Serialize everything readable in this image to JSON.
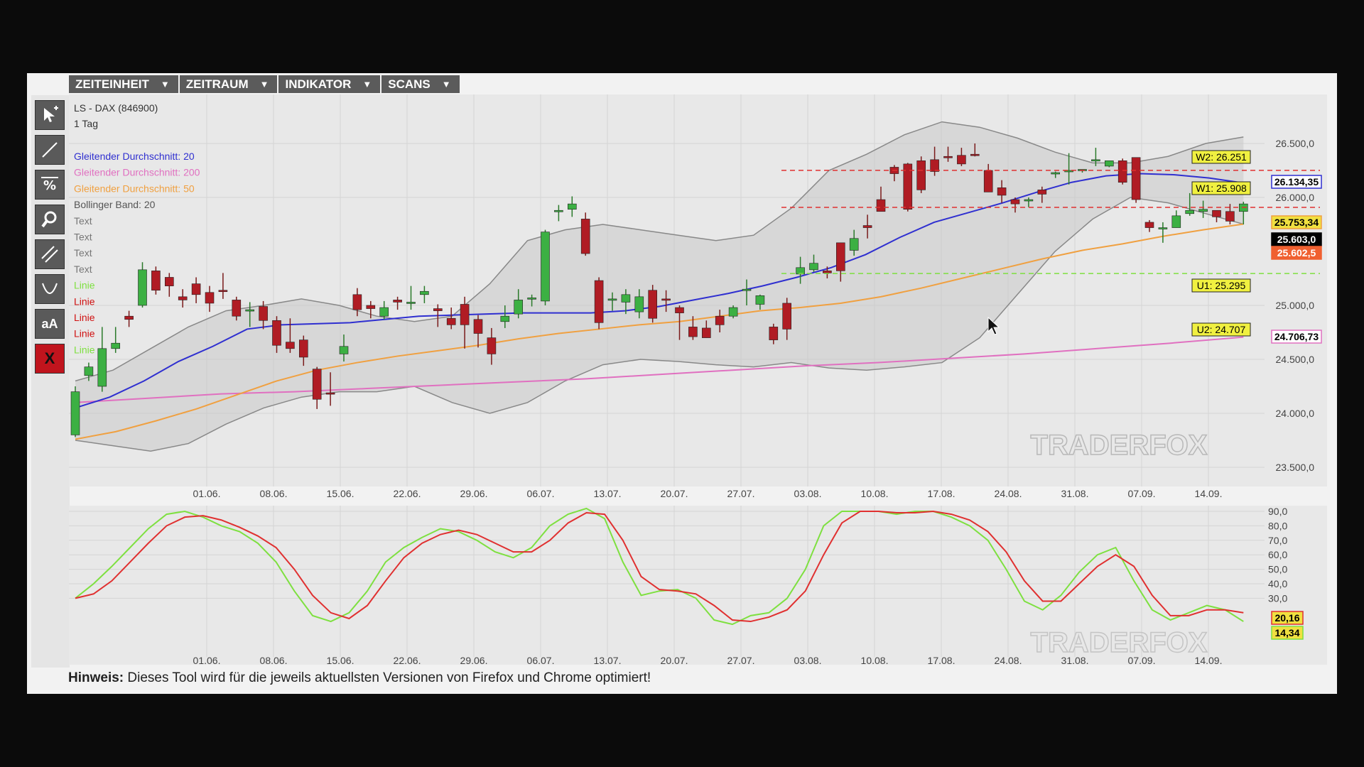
{
  "menu": [
    {
      "label": "ZEITEINHEIT",
      "arrow": "▼"
    },
    {
      "label": "ZEITRAUM",
      "arrow": "▼"
    },
    {
      "label": "INDIKATOR",
      "arrow": "▼"
    },
    {
      "label": "SCANS",
      "arrow": "▼"
    }
  ],
  "tools": [
    {
      "name": "select-arrow-icon"
    },
    {
      "name": "line-tool-icon"
    },
    {
      "name": "percent-tool-icon"
    },
    {
      "name": "zoom-icon"
    },
    {
      "name": "parallel-lines-icon"
    },
    {
      "name": "arc-tool-icon"
    },
    {
      "name": "text-size-icon",
      "label": "aA"
    },
    {
      "name": "delete-icon",
      "label": "X"
    }
  ],
  "legend": {
    "instrument": "LS - DAX (846900)",
    "timeframe": "1 Tag",
    "items": [
      {
        "label": "Gleitender Durchschnitt: 20",
        "color": "#2f2fd0"
      },
      {
        "label": "Gleitender Durchschnitt: 200",
        "color": "#e070c0"
      },
      {
        "label": "Gleitender Durchschnitt: 50",
        "color": "#f0a040"
      },
      {
        "label": "Bollinger Band: 20",
        "color": "#555555"
      },
      {
        "label": "Text",
        "color": "#777777"
      },
      {
        "label": "Text",
        "color": "#777777"
      },
      {
        "label": "Text",
        "color": "#777777"
      },
      {
        "label": "Text",
        "color": "#777777"
      },
      {
        "label": "Linie",
        "color": "#7ee040"
      },
      {
        "label": "Linie",
        "color": "#d01010"
      },
      {
        "label": "Linie",
        "color": "#d01010"
      },
      {
        "label": "Linie",
        "color": "#d01010"
      },
      {
        "label": "Linie",
        "color": "#7ee040"
      }
    ]
  },
  "x_ticks": [
    "01.06.",
    "08.06.",
    "15.06.",
    "22.06.",
    "29.06.",
    "06.07.",
    "13.07.",
    "20.07.",
    "27.07.",
    "03.08.",
    "10.08.",
    "17.08.",
    "24.08.",
    "31.08.",
    "07.09.",
    "14.09."
  ],
  "price_axis": {
    "ticks": [
      "26.500,0",
      "26.000,0",
      "25.000,0",
      "24.500,0",
      "24.000,0",
      "23.500,0"
    ],
    "ticks_values": [
      26500,
      26000,
      25000,
      24500,
      24000,
      23500
    ]
  },
  "osc_axis": {
    "ticks": [
      "90,0",
      "80,0",
      "70,0",
      "60,0",
      "50,0",
      "40,0",
      "30,0"
    ],
    "ticks_values": [
      90,
      80,
      70,
      60,
      50,
      40,
      30
    ]
  },
  "levels": [
    {
      "label": "W2: 26.251",
      "value": 26251,
      "color": "#e03030"
    },
    {
      "label": "W1: 25.908",
      "value": 25908,
      "color": "#e03030"
    },
    {
      "label": "U1: 25.295",
      "value": 25295,
      "color": "#7ee040"
    },
    {
      "label": "U2: 24.707",
      "value": 24707,
      "color": "none"
    }
  ],
  "price_tags": [
    {
      "label": "26.134,35",
      "value": 26134,
      "bg": "#ffffff",
      "fg": "#000000",
      "border": "#2f2fd0"
    },
    {
      "label": "25.753,34",
      "value": 25753,
      "bg": "#f0e040",
      "fg": "#000000",
      "border": "#f0a040"
    },
    {
      "label": "25.603,0",
      "value": 25603,
      "bg": "#000000",
      "fg": "#ffffff",
      "border": "#000000"
    },
    {
      "label": "25.602,5",
      "value": 25602,
      "bg": "#f06030",
      "fg": "#ffffff",
      "border": "#f06030"
    },
    {
      "label": "24.706,73",
      "value": 24706,
      "bg": "#ffffff",
      "fg": "#000000",
      "border": "#e070c0"
    }
  ],
  "osc_tags": [
    {
      "label": "20,16",
      "value": 20.16,
      "bg": "#f0e040",
      "border": "#e03030"
    },
    {
      "label": "14,34",
      "value": 14.34,
      "bg": "#f0e040",
      "border": "#7ee040"
    }
  ],
  "watermark": "TRADERFOX",
  "footer": {
    "bold": "Hinweis:",
    "text": " Dieses Tool wird für die jeweils aktuellsten Versionen von Firefox und Chrome optimiert!"
  },
  "chart_data": {
    "type": "candlestick",
    "candles_ohlc": [
      [
        23800,
        24200,
        23780,
        24250
      ],
      [
        24350,
        24430,
        24300,
        24470
      ],
      [
        24250,
        24600,
        24200,
        24800
      ],
      [
        24600,
        24650,
        24560,
        24800
      ],
      [
        24900,
        24870,
        24800,
        24950
      ],
      [
        25000,
        25330,
        24980,
        25400
      ],
      [
        25320,
        25140,
        25100,
        25360
      ],
      [
        25260,
        25180,
        25080,
        25300
      ],
      [
        25080,
        25050,
        24980,
        25150
      ],
      [
        25200,
        25100,
        25020,
        25260
      ],
      [
        25120,
        25020,
        24940,
        25180
      ],
      [
        25140,
        25130,
        25060,
        25300
      ],
      [
        25050,
        24900,
        24860,
        25080
      ],
      [
        24950,
        24960,
        24800,
        25030
      ],
      [
        24990,
        24860,
        24780,
        25040
      ],
      [
        24860,
        24630,
        24560,
        24900
      ],
      [
        24660,
        24600,
        24560,
        24880
      ],
      [
        24680,
        24520,
        24440,
        24720
      ],
      [
        24410,
        24130,
        24040,
        24430
      ],
      [
        24190,
        24180,
        24070,
        24380
      ],
      [
        24550,
        24620,
        24480,
        24730
      ],
      [
        25100,
        24960,
        24900,
        25160
      ],
      [
        25000,
        24970,
        24880,
        25040
      ],
      [
        24900,
        24980,
        24870,
        25040
      ],
      [
        25050,
        25030,
        24960,
        25080
      ],
      [
        25020,
        25030,
        24960,
        25180
      ],
      [
        25100,
        25130,
        25020,
        25180
      ],
      [
        24970,
        24950,
        24800,
        25010
      ],
      [
        24880,
        24820,
        24780,
        24980
      ],
      [
        25010,
        24820,
        24600,
        25080
      ],
      [
        24870,
        24740,
        24610,
        24910
      ],
      [
        24700,
        24550,
        24450,
        24790
      ],
      [
        24850,
        24900,
        24790,
        25000
      ],
      [
        24920,
        25050,
        24880,
        25150
      ],
      [
        25060,
        25070,
        24990,
        25100
      ],
      [
        25040,
        25680,
        25000,
        25700
      ],
      [
        25870,
        25880,
        25780,
        25930
      ],
      [
        25890,
        25940,
        25820,
        26010
      ],
      [
        25800,
        25480,
        25460,
        25860
      ],
      [
        25230,
        24840,
        24780,
        25260
      ],
      [
        25050,
        25060,
        24950,
        25120
      ],
      [
        25030,
        25100,
        24920,
        25150
      ],
      [
        24940,
        25080,
        24880,
        25150
      ],
      [
        25140,
        24880,
        24840,
        25190
      ],
      [
        25060,
        25050,
        24940,
        25140
      ],
      [
        24980,
        24930,
        24680,
        25000
      ],
      [
        24800,
        24710,
        24680,
        24900
      ],
      [
        24790,
        24700,
        24700,
        24860
      ],
      [
        24900,
        24820,
        24750,
        24960
      ],
      [
        24900,
        24980,
        24880,
        25000
      ],
      [
        25150,
        25150,
        25000,
        25240
      ],
      [
        25010,
        25090,
        24960,
        25100
      ],
      [
        24800,
        24680,
        24640,
        24830
      ],
      [
        25020,
        24780,
        24680,
        25070
      ],
      [
        25290,
        25350,
        25200,
        25450
      ],
      [
        25330,
        25390,
        25310,
        25470
      ],
      [
        25320,
        25300,
        25250,
        25360
      ],
      [
        25580,
        25320,
        25220,
        25470
      ],
      [
        25510,
        25620,
        25460,
        25700
      ],
      [
        25740,
        25720,
        25620,
        25840
      ],
      [
        25980,
        25870,
        25870,
        26100
      ],
      [
        26280,
        26220,
        26150,
        26300
      ],
      [
        26310,
        25890,
        25870,
        26320
      ],
      [
        26340,
        26070,
        26040,
        26380
      ],
      [
        26350,
        26240,
        26200,
        26470
      ],
      [
        26380,
        26370,
        26330,
        26470
      ],
      [
        26390,
        26310,
        26290,
        26460
      ],
      [
        26400,
        26390,
        26380,
        26500
      ],
      [
        26250,
        26050,
        26050,
        26310
      ],
      [
        26090,
        26020,
        25950,
        26160
      ],
      [
        25980,
        25940,
        25860,
        26000
      ],
      [
        25970,
        25980,
        25910,
        26000
      ],
      [
        26070,
        26030,
        25950,
        26100
      ],
      [
        26230,
        26230,
        26180,
        26240
      ],
      [
        26250,
        26250,
        26120,
        26410
      ],
      [
        26260,
        26260,
        26230,
        26260
      ],
      [
        26340,
        26350,
        26290,
        26460
      ],
      [
        26290,
        26340,
        26280,
        26330
      ],
      [
        26340,
        26140,
        26120,
        26360
      ],
      [
        26370,
        25980,
        25950,
        26030
      ],
      [
        25770,
        25720,
        25680,
        25790
      ],
      [
        25710,
        25720,
        25580,
        25770
      ],
      [
        25720,
        25830,
        25720,
        25880
      ],
      [
        25850,
        25880,
        25830,
        26040
      ],
      [
        25870,
        25890,
        25810,
        25970
      ],
      [
        25880,
        25820,
        25770,
        25870
      ],
      [
        25870,
        25780,
        25750,
        25940
      ],
      [
        25870,
        25940,
        25750,
        25960
      ]
    ],
    "sma20": [
      24050,
      24150,
      24300,
      24480,
      24620,
      24780,
      24820,
      24830,
      24840,
      24870,
      24900,
      24910,
      24920,
      24930,
      24930,
      24930,
      24950,
      24990,
      25050,
      25110,
      25180,
      25260,
      25350,
      25470,
      25630,
      25770,
      25860,
      25950,
      26050,
      26140,
      26200,
      26220,
      26210,
      26180,
      26134
    ],
    "sma50": [
      23760,
      23830,
      23930,
      24040,
      24170,
      24300,
      24400,
      24470,
      24530,
      24580,
      24630,
      24690,
      24740,
      24780,
      24820,
      24850,
      24900,
      24950,
      24980,
      25020,
      25080,
      25160,
      25250,
      25340,
      25430,
      25510,
      25570,
      25640,
      25700,
      25753
    ],
    "sma200": [
      24100,
      24140,
      24180,
      24200,
      24230,
      24260,
      24290,
      24320,
      24360,
      24400,
      24440,
      24470,
      24510,
      24550,
      24600,
      24650,
      24706
    ],
    "bb_upper": [
      24300,
      24400,
      24600,
      24800,
      24950,
      25000,
      25060,
      25000,
      24900,
      24850,
      24900,
      25200,
      25600,
      25700,
      25750,
      25700,
      25650,
      25600,
      25650,
      25900,
      26250,
      26400,
      26580,
      26700,
      26650,
      26550,
      26420,
      26320,
      26320,
      26380,
      26500,
      26560
    ],
    "bb_lower": [
      23750,
      23700,
      23650,
      23720,
      23900,
      24050,
      24150,
      24200,
      24200,
      24250,
      24100,
      24000,
      24100,
      24300,
      24450,
      24500,
      24480,
      24450,
      24430,
      24470,
      24420,
      24400,
      24430,
      24470,
      24700,
      25100,
      25500,
      25800,
      26000,
      25950,
      25850,
      25753
    ],
    "stoch_k": [
      30,
      40,
      52,
      65,
      78,
      88,
      90,
      86,
      80,
      76,
      68,
      55,
      35,
      18,
      14,
      20,
      35,
      55,
      65,
      72,
      78,
      76,
      70,
      62,
      58,
      65,
      80,
      88,
      92,
      85,
      55,
      32,
      35,
      36,
      30,
      15,
      12,
      18,
      20,
      30,
      50,
      80,
      90,
      90,
      90,
      88,
      90,
      90,
      86,
      80,
      70,
      50,
      28,
      22,
      32,
      48,
      60,
      65,
      42,
      22,
      15,
      20,
      25,
      22,
      14
    ],
    "stoch_d": [
      30,
      33,
      42,
      55,
      68,
      80,
      86,
      87,
      84,
      79,
      73,
      65,
      50,
      32,
      20,
      16,
      25,
      42,
      58,
      68,
      74,
      77,
      74,
      68,
      62,
      62,
      70,
      82,
      89,
      88,
      70,
      45,
      36,
      35,
      33,
      25,
      15,
      14,
      17,
      22,
      35,
      60,
      82,
      90,
      90,
      89,
      89,
      90,
      88,
      84,
      76,
      62,
      42,
      28,
      28,
      40,
      52,
      60,
      52,
      32,
      18,
      18,
      22,
      22,
      20
    ]
  }
}
